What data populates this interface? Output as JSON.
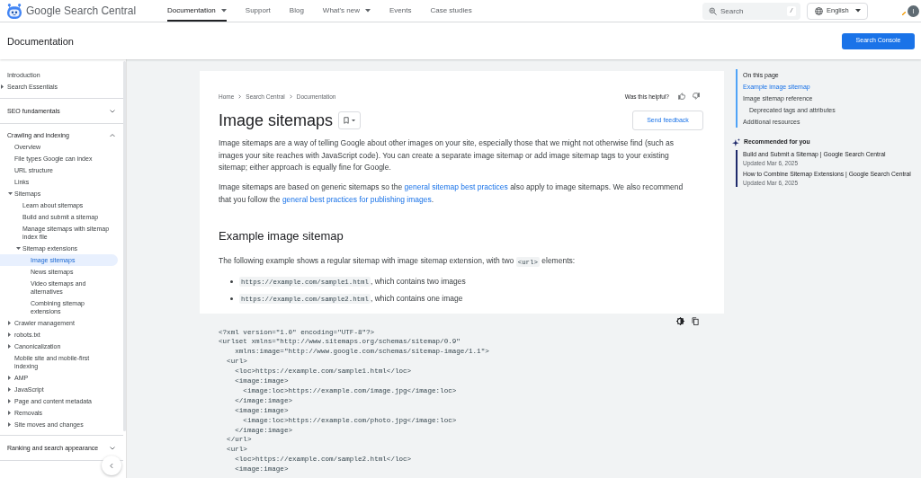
{
  "header": {
    "logo": "Google Search Central",
    "nav": [
      {
        "label": "Documentation",
        "selected": true,
        "has_menu": true
      },
      {
        "label": "Support",
        "selected": false,
        "has_menu": false
      },
      {
        "label": "Blog",
        "selected": false,
        "has_menu": false
      },
      {
        "label": "What's new",
        "selected": false,
        "has_menu": true
      },
      {
        "label": "Events",
        "selected": false,
        "has_menu": false
      },
      {
        "label": "Case studies",
        "selected": false,
        "has_menu": false
      }
    ],
    "search": {
      "placeholder": "Search",
      "shortcut": "/"
    },
    "language": "English",
    "avatar": "I"
  },
  "subheader": {
    "title": "Documentation",
    "button": "Search Console"
  },
  "sidebar": {
    "items": [
      {
        "kind": "link",
        "label": "Introduction",
        "selected": false
      },
      {
        "kind": "group",
        "label": "Search Essentials",
        "selected": false,
        "expanded": false
      },
      {
        "kind": "section",
        "label": "SEO fundamentals",
        "selected": false,
        "expanded": false
      },
      {
        "kind": "section",
        "label": "Crawling and indexing",
        "selected": false,
        "expanded": true,
        "children": [
          {
            "kind": "link",
            "label": "Overview",
            "selected": false
          },
          {
            "kind": "link",
            "label": "File types Google can index",
            "selected": false
          },
          {
            "kind": "link",
            "label": "URL structure",
            "selected": false
          },
          {
            "kind": "link",
            "label": "Links",
            "selected": false
          },
          {
            "kind": "group",
            "label": "Sitemaps",
            "selected": false,
            "expanded": true,
            "children": [
              {
                "kind": "link",
                "label": "Learn about sitemaps",
                "selected": false
              },
              {
                "kind": "link",
                "label": "Build and submit a sitemap",
                "selected": false
              },
              {
                "kind": "link",
                "label": "Manage sitemaps with sitemap index file",
                "selected": false
              },
              {
                "kind": "group",
                "label": "Sitemap extensions",
                "selected": false,
                "expanded": true,
                "children": [
                  {
                    "kind": "link",
                    "label": "Image sitemaps",
                    "selected": true
                  },
                  {
                    "kind": "link",
                    "label": "News sitemaps",
                    "selected": false
                  },
                  {
                    "kind": "link",
                    "label": "Video sitemaps and alternatives",
                    "selected": false
                  },
                  {
                    "kind": "link",
                    "label": "Combining sitemap extensions",
                    "selected": false
                  }
                ]
              }
            ]
          },
          {
            "kind": "group",
            "label": "Crawler management",
            "selected": false,
            "expanded": false
          },
          {
            "kind": "group",
            "label": "robots.txt",
            "selected": false,
            "expanded": false
          },
          {
            "kind": "group",
            "label": "Canonicalization",
            "selected": false,
            "expanded": false
          },
          {
            "kind": "link",
            "label": "Mobile site and mobile-first indexing",
            "selected": false
          },
          {
            "kind": "group",
            "label": "AMP",
            "selected": false,
            "expanded": false
          },
          {
            "kind": "group",
            "label": "JavaScript",
            "selected": false,
            "expanded": false
          },
          {
            "kind": "group",
            "label": "Page and content metadata",
            "selected": false,
            "expanded": false
          },
          {
            "kind": "group",
            "label": "Removals",
            "selected": false,
            "expanded": false
          },
          {
            "kind": "group",
            "label": "Site moves and changes",
            "selected": false,
            "expanded": false
          }
        ]
      },
      {
        "kind": "section",
        "label": "Ranking and search appearance",
        "selected": false,
        "expanded": false
      }
    ]
  },
  "article": {
    "breadcrumbs": [
      "Home",
      "Search Central",
      "Documentation"
    ],
    "helpful_prompt": "Was this helpful?",
    "title": "Image sitemaps",
    "feedback_button": "Send feedback",
    "intro": [
      [
        {
          "kind": "text",
          "text": "Image sitemaps are a way of telling Google about other images on your site, especially those that we might not otherwise find (such as images your site reaches with JavaScript code). You can create a separate image sitemap or add image sitemap tags to your existing sitemap; either approach is equally fine for Google."
        }
      ],
      [
        {
          "kind": "text",
          "text": "Image sitemaps are based on generic sitemaps so the "
        },
        {
          "kind": "link",
          "text": "general sitemap best practices"
        },
        {
          "kind": "text",
          "text": " also apply to image sitemaps. We also recommend that you follow the "
        },
        {
          "kind": "link",
          "text": "general best practices for publishing images"
        },
        {
          "kind": "text",
          "text": "."
        }
      ]
    ],
    "sections": [
      {
        "heading": "Example image sitemap",
        "paragraph": [
          {
            "kind": "text",
            "text": "The following example shows a regular sitemap with image sitemap extension, with two "
          },
          {
            "kind": "code",
            "text": "<url>"
          },
          {
            "kind": "text",
            "text": " elements:"
          }
        ],
        "bullets": [
          [
            {
              "kind": "code",
              "text": "https://example.com/sample1.html"
            },
            {
              "kind": "text",
              "text": ", which contains two images"
            }
          ],
          [
            {
              "kind": "code",
              "text": "https://example.com/sample2.html"
            },
            {
              "kind": "text",
              "text": ", which contains one image"
            }
          ]
        ],
        "code": [
          "<?xml version=\"1.0\" encoding=\"UTF-8\"?>",
          "<urlset xmlns=\"http://www.sitemaps.org/schemas/sitemap/0.9\"",
          "    xmlns:image=\"http://www.google.com/schemas/sitemap-image/1.1\">",
          "  <url>",
          "    <loc>https://example.com/sample1.html</loc>",
          "    <image:image>",
          "      <image:loc>https://example.com/image.jpg</image:loc>",
          "    </image:image>",
          "    <image:image>",
          "      <image:loc>https://example.com/photo.jpg</image:loc>",
          "    </image:image>",
          "  </url>",
          "  <url>",
          "    <loc>https://example.com/sample2.html</loc>",
          "    <image:image>"
        ]
      }
    ]
  },
  "toc": {
    "heading": "On this page",
    "items": [
      {
        "label": "Example image sitemap",
        "selected": true
      },
      {
        "label": "Image sitemap reference",
        "selected": false,
        "children": [
          {
            "label": "Deprecated tags and attributes",
            "selected": false
          }
        ]
      },
      {
        "label": "Additional resources",
        "selected": false
      }
    ]
  },
  "recommended": {
    "heading": "Recommended for you",
    "items": [
      {
        "title": "Build and Submit a Sitemap | Google Search Central",
        "updated": "Updated Mar 6, 2025"
      },
      {
        "title": "How to Combine Sitemap Extensions | Google Search Central",
        "updated": "Updated Mar 6, 2025"
      }
    ]
  }
}
